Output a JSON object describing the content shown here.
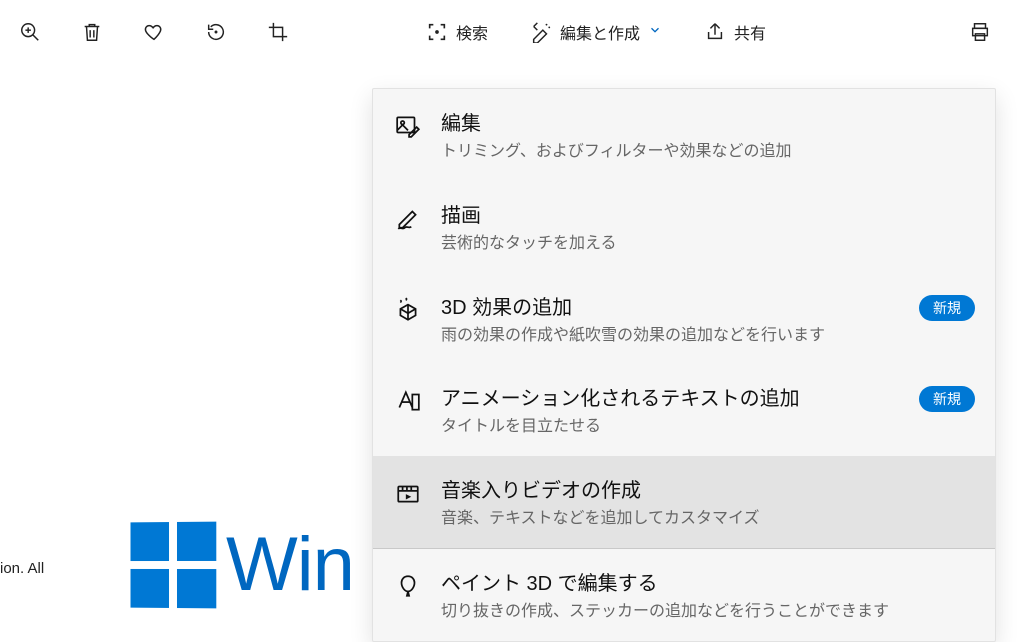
{
  "toolbar": {
    "search_label": "検索",
    "edit_create_label": "編集と作成",
    "share_label": "共有"
  },
  "menu": {
    "items": [
      {
        "title": "編集",
        "desc": "トリミング、およびフィルターや効果などの追加",
        "badge": ""
      },
      {
        "title": "描画",
        "desc": "芸術的なタッチを加える",
        "badge": ""
      },
      {
        "title": "3D 効果の追加",
        "desc": "雨の効果の作成や紙吹雪の効果の追加などを行います",
        "badge": "新規"
      },
      {
        "title": "アニメーション化されるテキストの追加",
        "desc": "タイトルを目立たせる",
        "badge": "新規"
      },
      {
        "title": "音楽入りビデオの作成",
        "desc": "音楽、テキストなどを追加してカスタマイズ",
        "badge": ""
      },
      {
        "title": "ペイント 3D で編集する",
        "desc": "切り抜きの作成、ステッカーの追加などを行うことができます",
        "badge": ""
      }
    ]
  },
  "background": {
    "caption_fragment": "ion. All",
    "logo_text_fragment": "Win"
  }
}
